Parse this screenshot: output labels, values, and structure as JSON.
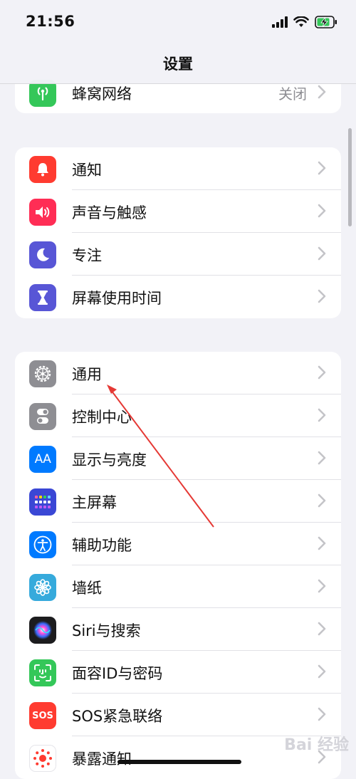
{
  "status": {
    "time": "21:56"
  },
  "nav": {
    "title": "设置"
  },
  "groups": [
    {
      "rows": [
        {
          "label": "蜂窝网络",
          "value": "关闭",
          "icon": "cellular-antenna-icon",
          "color": "#34c759"
        }
      ]
    },
    {
      "rows": [
        {
          "label": "通知",
          "icon": "bell-icon",
          "color": "#ff3b30"
        },
        {
          "label": "声音与触感",
          "icon": "speaker-icon",
          "color": "#ff2d55"
        },
        {
          "label": "专注",
          "icon": "moon-icon",
          "color": "#5856d6"
        },
        {
          "label": "屏幕使用时间",
          "icon": "hourglass-icon",
          "color": "#5856d6"
        }
      ]
    },
    {
      "rows": [
        {
          "label": "通用",
          "icon": "gear-icon",
          "color": "#8e8e93"
        },
        {
          "label": "控制中心",
          "icon": "toggles-icon",
          "color": "#8e8e93"
        },
        {
          "label": "显示与亮度",
          "icon": "text-size-icon",
          "icon_text": "AA",
          "color": "#007aff"
        },
        {
          "label": "主屏幕",
          "icon": "app-grid-icon",
          "color": "#3a47d5"
        },
        {
          "label": "辅助功能",
          "icon": "accessibility-icon",
          "color": "#007aff"
        },
        {
          "label": "墙纸",
          "icon": "flower-icon",
          "color": "#36aadc"
        },
        {
          "label": "Siri与搜索",
          "icon": "siri-icon",
          "color": "#222222"
        },
        {
          "label": "面容ID与密码",
          "icon": "face-id-icon",
          "color": "#34c759"
        },
        {
          "label": "SOS紧急联络",
          "icon": "sos-icon",
          "icon_text": "SOS",
          "color": "#ff3b30"
        },
        {
          "label": "暴露通知",
          "icon": "exposure-icon",
          "color": "#ffffff"
        }
      ]
    }
  ],
  "watermark": "Bai 经验"
}
